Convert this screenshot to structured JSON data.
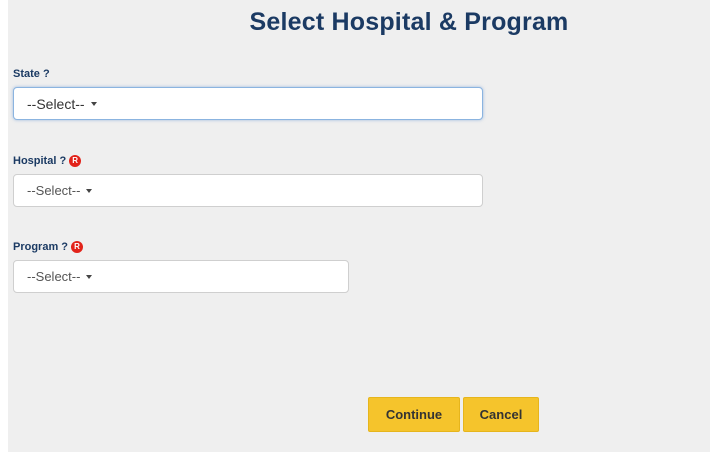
{
  "header": {
    "title": "Select Hospital & Program"
  },
  "form": {
    "state": {
      "label": "State ?",
      "selected": "--Select--",
      "required": false
    },
    "hospital": {
      "label": "Hospital ?",
      "selected": "--Select--",
      "required": true,
      "required_badge": "R"
    },
    "program": {
      "label": "Program ?",
      "selected": "--Select--",
      "required": true,
      "required_badge": "R"
    }
  },
  "actions": {
    "continue_label": "Continue",
    "cancel_label": "Cancel"
  },
  "colors": {
    "title": "#1b3a63",
    "button": "#f5c42c",
    "required_icon": "#e2231a",
    "panel_background": "#efefef"
  }
}
